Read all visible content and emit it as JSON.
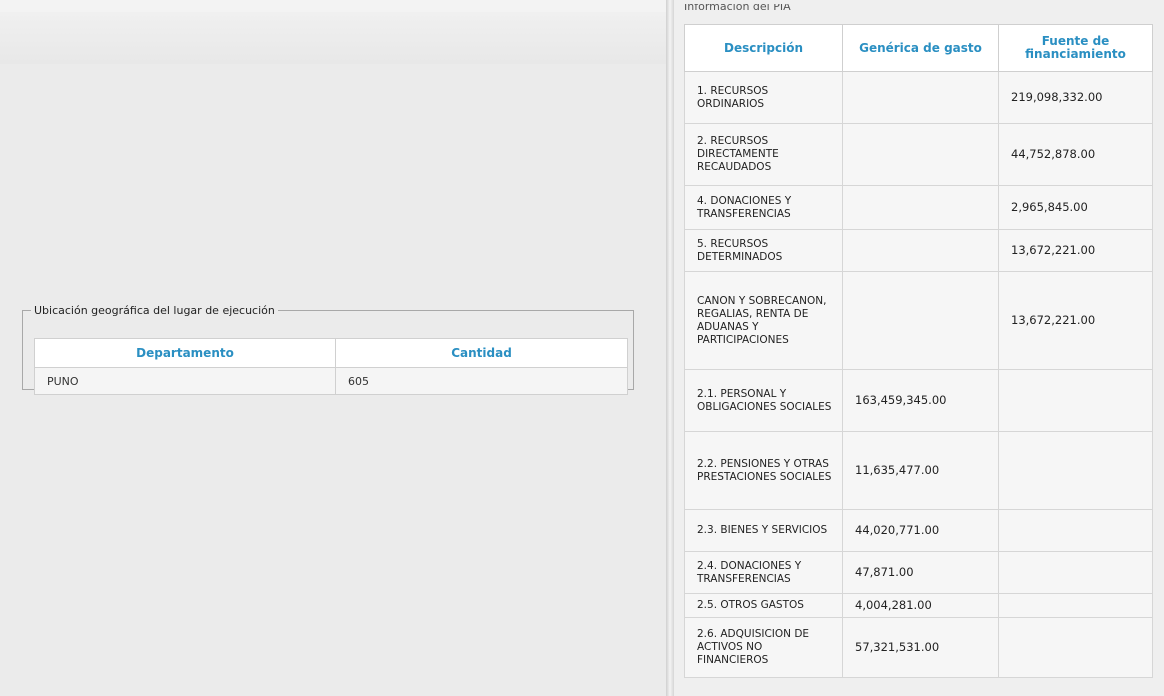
{
  "geo": {
    "legend": "Ubicación geográfica del lugar de ejecución",
    "columns": [
      "Departamento",
      "Cantidad"
    ],
    "rows": [
      {
        "departamento": "PUNO",
        "cantidad": "605"
      }
    ]
  },
  "pia": {
    "legend": "Información del PIA",
    "columns": [
      "Descripción",
      "Genérica de gasto",
      "Fuente de financiamiento"
    ],
    "rows": [
      {
        "descripcion": "1. RECURSOS ORDINARIOS",
        "generica": "",
        "fuente": "219,098,332.00"
      },
      {
        "descripcion": "2. RECURSOS DIRECTAMENTE RECAUDADOS",
        "generica": "",
        "fuente": "44,752,878.00"
      },
      {
        "descripcion": "4. DONACIONES Y TRANSFERENCIAS",
        "generica": "",
        "fuente": "2,965,845.00"
      },
      {
        "descripcion": "5. RECURSOS DETERMINADOS",
        "generica": "",
        "fuente": "13,672,221.00"
      },
      {
        "descripcion": "CANON Y SOBRECANON, REGALIAS, RENTA DE ADUANAS Y PARTICIPACIONES",
        "generica": "",
        "fuente": "13,672,221.00"
      },
      {
        "descripcion": "2.1. PERSONAL Y OBLIGACIONES SOCIALES",
        "generica": "163,459,345.00",
        "fuente": ""
      },
      {
        "descripcion": "2.2. PENSIONES Y OTRAS PRESTACIONES SOCIALES",
        "generica": "11,635,477.00",
        "fuente": ""
      },
      {
        "descripcion": "2.3. BIENES Y SERVICIOS",
        "generica": "44,020,771.00",
        "fuente": ""
      },
      {
        "descripcion": "2.4. DONACIONES Y TRANSFERENCIAS",
        "generica": "47,871.00",
        "fuente": ""
      },
      {
        "descripcion": "2.5. OTROS GASTOS",
        "generica": "4,004,281.00",
        "fuente": ""
      },
      {
        "descripcion": "2.6. ADQUISICION DE ACTIVOS NO FINANCIEROS",
        "generica": "57,321,531.00",
        "fuente": ""
      }
    ]
  }
}
